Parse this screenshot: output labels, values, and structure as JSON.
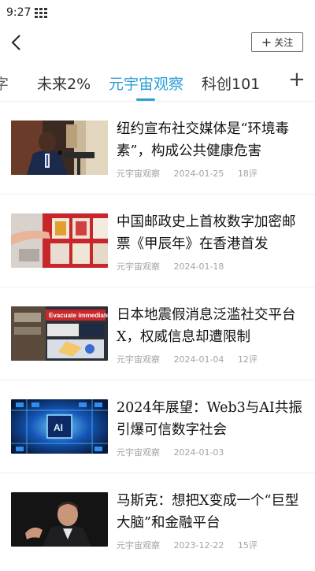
{
  "status_bar": {
    "time": "9:27"
  },
  "nav": {
    "follow_label": "关注"
  },
  "tabs": {
    "items": [
      {
        "label": "字",
        "state": "partial"
      },
      {
        "label": "未来2%",
        "state": "normal"
      },
      {
        "label": "元宇宙观察",
        "state": "active"
      },
      {
        "label": "科创101",
        "state": "normal"
      }
    ],
    "more_icon": "plus-icon"
  },
  "colors": {
    "accent": "#2a9fd6",
    "meta_text": "#a3a3a3"
  },
  "articles": [
    {
      "title": "纽约宣布社交媒体是“环境毒素”，构成公共健康危害",
      "source": "元宇宙观察",
      "date": "2024-01-25",
      "comments": "18评",
      "thumb": "speaker-at-podium"
    },
    {
      "title": "中国邮政史上首枚数字加密邮票《甲辰年》在香港首发",
      "source": "元宇宙观察",
      "date": "2024-01-18",
      "comments": "",
      "thumb": "red-stamp-display"
    },
    {
      "title": "日本地震假消息泛滥社交平台X，权威信息却遭限制",
      "source": "元宇宙观察",
      "date": "2024-01-04",
      "comments": "12评",
      "thumb": "evacuation-broadcast-screen"
    },
    {
      "title": "2024年展望：Web3与AI共振引爆可信数字社会",
      "source": "元宇宙观察",
      "date": "2024-01-03",
      "comments": "",
      "thumb": "ai-chip-blue"
    },
    {
      "title": "马斯克：想把X变成一个“巨型大脑”和金融平台",
      "source": "元宇宙观察",
      "date": "2023-12-22",
      "comments": "15评",
      "thumb": "man-in-suit-dark"
    }
  ]
}
